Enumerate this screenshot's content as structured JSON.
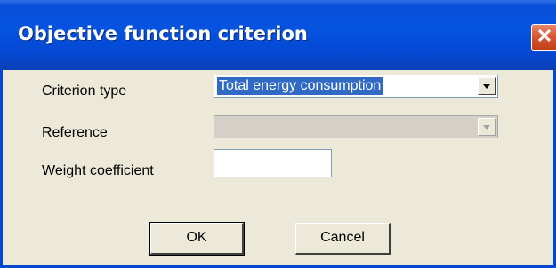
{
  "dialog": {
    "title": "Objective function criterion"
  },
  "fields": {
    "criterion_type": {
      "label": "Criterion type",
      "value": "Total energy consumption"
    },
    "reference": {
      "label": "Reference",
      "value": ""
    },
    "weight_coefficient": {
      "label": "Weight coefficient",
      "value": ""
    }
  },
  "buttons": {
    "ok": "OK",
    "cancel": "Cancel"
  },
  "icons": {
    "close": "close-icon",
    "dropdown": "chevron-down-icon"
  },
  "colors": {
    "titlebar": "#0553e0",
    "face": "#ece9d8",
    "selection": "#316ac5",
    "close": "#d7542f"
  }
}
